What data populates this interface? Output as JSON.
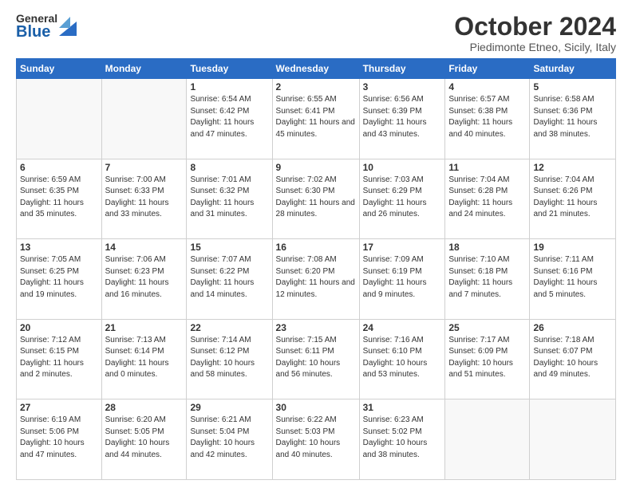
{
  "header": {
    "logo_general": "General",
    "logo_blue": "Blue",
    "month_title": "October 2024",
    "location": "Piedimonte Etneo, Sicily, Italy"
  },
  "days_of_week": [
    "Sunday",
    "Monday",
    "Tuesday",
    "Wednesday",
    "Thursday",
    "Friday",
    "Saturday"
  ],
  "weeks": [
    [
      {
        "day": "",
        "info": ""
      },
      {
        "day": "",
        "info": ""
      },
      {
        "day": "1",
        "info": "Sunrise: 6:54 AM\nSunset: 6:42 PM\nDaylight: 11 hours and 47 minutes."
      },
      {
        "day": "2",
        "info": "Sunrise: 6:55 AM\nSunset: 6:41 PM\nDaylight: 11 hours and 45 minutes."
      },
      {
        "day": "3",
        "info": "Sunrise: 6:56 AM\nSunset: 6:39 PM\nDaylight: 11 hours and 43 minutes."
      },
      {
        "day": "4",
        "info": "Sunrise: 6:57 AM\nSunset: 6:38 PM\nDaylight: 11 hours and 40 minutes."
      },
      {
        "day": "5",
        "info": "Sunrise: 6:58 AM\nSunset: 6:36 PM\nDaylight: 11 hours and 38 minutes."
      }
    ],
    [
      {
        "day": "6",
        "info": "Sunrise: 6:59 AM\nSunset: 6:35 PM\nDaylight: 11 hours and 35 minutes."
      },
      {
        "day": "7",
        "info": "Sunrise: 7:00 AM\nSunset: 6:33 PM\nDaylight: 11 hours and 33 minutes."
      },
      {
        "day": "8",
        "info": "Sunrise: 7:01 AM\nSunset: 6:32 PM\nDaylight: 11 hours and 31 minutes."
      },
      {
        "day": "9",
        "info": "Sunrise: 7:02 AM\nSunset: 6:30 PM\nDaylight: 11 hours and 28 minutes."
      },
      {
        "day": "10",
        "info": "Sunrise: 7:03 AM\nSunset: 6:29 PM\nDaylight: 11 hours and 26 minutes."
      },
      {
        "day": "11",
        "info": "Sunrise: 7:04 AM\nSunset: 6:28 PM\nDaylight: 11 hours and 24 minutes."
      },
      {
        "day": "12",
        "info": "Sunrise: 7:04 AM\nSunset: 6:26 PM\nDaylight: 11 hours and 21 minutes."
      }
    ],
    [
      {
        "day": "13",
        "info": "Sunrise: 7:05 AM\nSunset: 6:25 PM\nDaylight: 11 hours and 19 minutes."
      },
      {
        "day": "14",
        "info": "Sunrise: 7:06 AM\nSunset: 6:23 PM\nDaylight: 11 hours and 16 minutes."
      },
      {
        "day": "15",
        "info": "Sunrise: 7:07 AM\nSunset: 6:22 PM\nDaylight: 11 hours and 14 minutes."
      },
      {
        "day": "16",
        "info": "Sunrise: 7:08 AM\nSunset: 6:20 PM\nDaylight: 11 hours and 12 minutes."
      },
      {
        "day": "17",
        "info": "Sunrise: 7:09 AM\nSunset: 6:19 PM\nDaylight: 11 hours and 9 minutes."
      },
      {
        "day": "18",
        "info": "Sunrise: 7:10 AM\nSunset: 6:18 PM\nDaylight: 11 hours and 7 minutes."
      },
      {
        "day": "19",
        "info": "Sunrise: 7:11 AM\nSunset: 6:16 PM\nDaylight: 11 hours and 5 minutes."
      }
    ],
    [
      {
        "day": "20",
        "info": "Sunrise: 7:12 AM\nSunset: 6:15 PM\nDaylight: 11 hours and 2 minutes."
      },
      {
        "day": "21",
        "info": "Sunrise: 7:13 AM\nSunset: 6:14 PM\nDaylight: 11 hours and 0 minutes."
      },
      {
        "day": "22",
        "info": "Sunrise: 7:14 AM\nSunset: 6:12 PM\nDaylight: 10 hours and 58 minutes."
      },
      {
        "day": "23",
        "info": "Sunrise: 7:15 AM\nSunset: 6:11 PM\nDaylight: 10 hours and 56 minutes."
      },
      {
        "day": "24",
        "info": "Sunrise: 7:16 AM\nSunset: 6:10 PM\nDaylight: 10 hours and 53 minutes."
      },
      {
        "day": "25",
        "info": "Sunrise: 7:17 AM\nSunset: 6:09 PM\nDaylight: 10 hours and 51 minutes."
      },
      {
        "day": "26",
        "info": "Sunrise: 7:18 AM\nSunset: 6:07 PM\nDaylight: 10 hours and 49 minutes."
      }
    ],
    [
      {
        "day": "27",
        "info": "Sunrise: 6:19 AM\nSunset: 5:06 PM\nDaylight: 10 hours and 47 minutes."
      },
      {
        "day": "28",
        "info": "Sunrise: 6:20 AM\nSunset: 5:05 PM\nDaylight: 10 hours and 44 minutes."
      },
      {
        "day": "29",
        "info": "Sunrise: 6:21 AM\nSunset: 5:04 PM\nDaylight: 10 hours and 42 minutes."
      },
      {
        "day": "30",
        "info": "Sunrise: 6:22 AM\nSunset: 5:03 PM\nDaylight: 10 hours and 40 minutes."
      },
      {
        "day": "31",
        "info": "Sunrise: 6:23 AM\nSunset: 5:02 PM\nDaylight: 10 hours and 38 minutes."
      },
      {
        "day": "",
        "info": ""
      },
      {
        "day": "",
        "info": ""
      }
    ]
  ]
}
